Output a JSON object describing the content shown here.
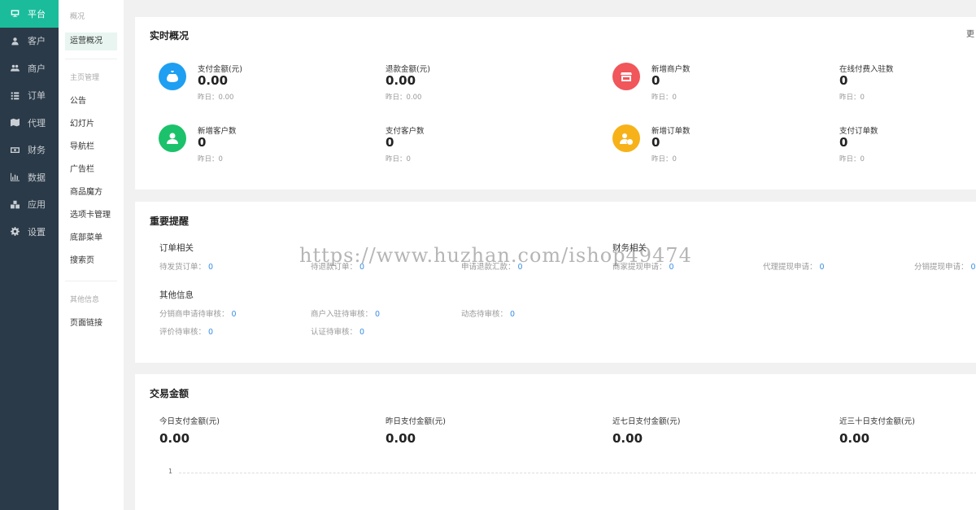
{
  "sidebar": {
    "items": [
      {
        "label": "平台",
        "icon": "monitor-icon"
      },
      {
        "label": "客户",
        "icon": "user-icon"
      },
      {
        "label": "商户",
        "icon": "users-icon"
      },
      {
        "label": "订单",
        "icon": "list-icon"
      },
      {
        "label": "代理",
        "icon": "map-icon"
      },
      {
        "label": "财务",
        "icon": "money-icon"
      },
      {
        "label": "数据",
        "icon": "bar-chart-icon"
      },
      {
        "label": "应用",
        "icon": "cubes-icon"
      },
      {
        "label": "设置",
        "icon": "gear-icon"
      }
    ]
  },
  "subnav": {
    "group1": "概况",
    "active_item": "运营概况",
    "group2": "主页管理",
    "items2": [
      "公告",
      "幻灯片",
      "导航栏",
      "广告栏",
      "商品魔方",
      "选项卡管理",
      "底部菜单",
      "搜索页"
    ],
    "group3": "其他信息",
    "items3": [
      "页面链接"
    ]
  },
  "realtime": {
    "title": "实时概况",
    "corner": "更",
    "stats": [
      {
        "label": "支付金额(元)",
        "value": "0.00",
        "sub": "昨日：0.00",
        "icon": "money-bag-icon",
        "color": "#1e9ff2"
      },
      {
        "label": "退款金额(元)",
        "value": "0.00",
        "sub": "昨日：0.00"
      },
      {
        "label": "新增商户数",
        "value": "0",
        "sub": "昨日：0",
        "icon": "store-icon",
        "color": "#f0565a"
      },
      {
        "label": "在线付费入驻数",
        "value": "0",
        "sub": "昨日：0"
      },
      {
        "label": "新增客户数",
        "value": "0",
        "sub": "昨日：0",
        "icon": "person-icon",
        "color": "#1bc26b"
      },
      {
        "label": "支付客户数",
        "value": "0",
        "sub": "昨日：0"
      },
      {
        "label": "新增订单数",
        "value": "0",
        "sub": "昨日：0",
        "icon": "user-add-icon",
        "color": "#f7b21a"
      },
      {
        "label": "支付订单数",
        "value": "0",
        "sub": "昨日：0"
      }
    ]
  },
  "reminders": {
    "title": "重要提醒",
    "order_head": "订单相关",
    "finance_head": "财务相关",
    "other_head": "其他信息",
    "row1": [
      {
        "label": "待发货订单：",
        "num": "0"
      },
      {
        "label": "待退款订单：",
        "num": "0"
      },
      {
        "label": "申请退款汇款：",
        "num": "0"
      },
      {
        "label": "商家提现申请：",
        "num": "0"
      },
      {
        "label": "代理提现申请：",
        "num": "0"
      },
      {
        "label": "分销提现申请：",
        "num": "0"
      }
    ],
    "row2": [
      {
        "label": "分销商申请待审核：",
        "num": "0"
      },
      {
        "label": "商户入驻待审核：",
        "num": "0"
      },
      {
        "label": "动态待审核：",
        "num": "0"
      }
    ],
    "row3": [
      {
        "label": "评价待审核：",
        "num": "0"
      },
      {
        "label": "认证待审核：",
        "num": "0"
      }
    ]
  },
  "trade": {
    "title": "交易金额",
    "amounts": [
      {
        "label": "今日支付金额(元)",
        "value": "0.00"
      },
      {
        "label": "昨日支付金额(元)",
        "value": "0.00"
      },
      {
        "label": "近七日支付金额(元)",
        "value": "0.00"
      },
      {
        "label": "近三十日支付金额(元)",
        "value": "0.00"
      }
    ],
    "axis_tick": "1"
  },
  "watermark": "https://www.huzhan.com/ishop49474",
  "colors": {
    "accent": "#1bbc9b",
    "sidebar": "#2b3a48",
    "link": "#3a8ee6"
  }
}
